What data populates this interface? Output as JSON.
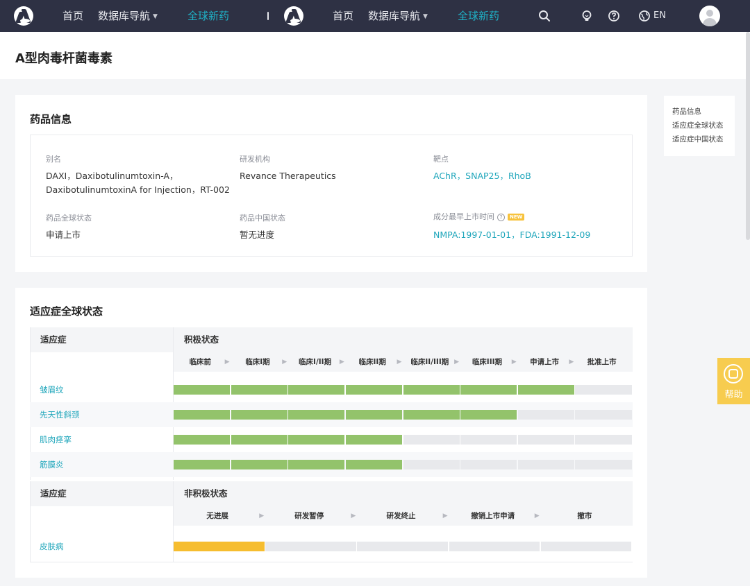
{
  "nav": {
    "home": "首页",
    "db_nav": "数据库导航",
    "global_drugs": "全球新药",
    "lang": "EN"
  },
  "page": {
    "title": "A型肉毒杆菌毒素"
  },
  "drug_info": {
    "heading": "药品信息",
    "alias_label": "别名",
    "alias_line1": "DAXI，Daxibotulinumtoxin-A，",
    "alias_line2": "DaxibotulinumtoxinA for Injection，RT-002",
    "org_label": "研发机构",
    "org_value": "Revance Therapeutics",
    "target_label": "靶点",
    "target_value": "AChR，SNAP25，RhoB",
    "global_status_label": "药品全球状态",
    "global_status_value": "申请上市",
    "china_status_label": "药品中国状态",
    "china_status_value": "暂无进度",
    "first_launch_label": "成分最早上市时间",
    "new_badge": "NEW",
    "help_mark": "?",
    "first_launch_value": "NMPA:1997-01-01，FDA:1991-12-09"
  },
  "global_status": {
    "heading": "适应症全球状态",
    "col_indication": "适应症",
    "col_active": "积极状态",
    "phases": [
      "临床前",
      "临床I期",
      "临床I/II期",
      "临床II期",
      "临床II/III期",
      "临床III期",
      "申请上市",
      "批准上市"
    ],
    "active_rows": [
      {
        "name": "皱眉纹",
        "completed": 7
      },
      {
        "name": "先天性斜颈",
        "completed": 6
      },
      {
        "name": "肌肉痉挛",
        "completed": 4
      },
      {
        "name": "筋膜炎",
        "completed": 4
      }
    ],
    "col_inactive": "非积极状态",
    "inactive_phases": [
      "无进展",
      "研发暂停",
      "研发终止",
      "撤销上市申请",
      "撤市"
    ],
    "inactive_rows": [
      {
        "name": "皮肤病",
        "status_index": 0
      }
    ],
    "colors": {
      "active": "#93c36b",
      "inactive": "#f6bd2f",
      "empty": "#e8e9ec"
    }
  },
  "toc": {
    "items": [
      "药品信息",
      "适应症全球状态",
      "适应症中国状态"
    ]
  },
  "help": {
    "label": "帮助"
  },
  "icons": [
    "search-icon",
    "bulb-icon",
    "question-icon",
    "globe-icon",
    "user-avatar",
    "chevron-down-icon",
    "chevron-right-icon"
  ]
}
